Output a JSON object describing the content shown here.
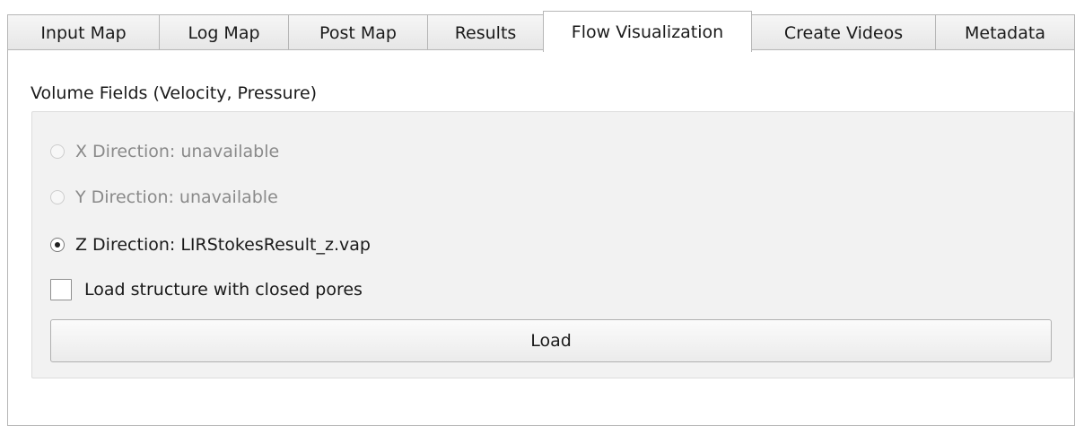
{
  "tabs": [
    {
      "label": "Input Map"
    },
    {
      "label": "Log Map"
    },
    {
      "label": "Post Map"
    },
    {
      "label": "Results"
    },
    {
      "label": "Flow Visualization"
    },
    {
      "label": "Create Videos"
    },
    {
      "label": "Metadata"
    }
  ],
  "active_tab": "Flow Visualization",
  "group": {
    "title": "Volume Fields (Velocity, Pressure)",
    "options": [
      {
        "label": "X Direction:  unavailable",
        "enabled": false,
        "checked": false
      },
      {
        "label": "Y Direction:  unavailable",
        "enabled": false,
        "checked": false
      },
      {
        "label": "Z Direction: LIRStokesResult_z.vap",
        "enabled": true,
        "checked": true
      }
    ],
    "checkbox": {
      "label": "Load structure with closed pores",
      "checked": false
    },
    "load_button": "Load"
  }
}
